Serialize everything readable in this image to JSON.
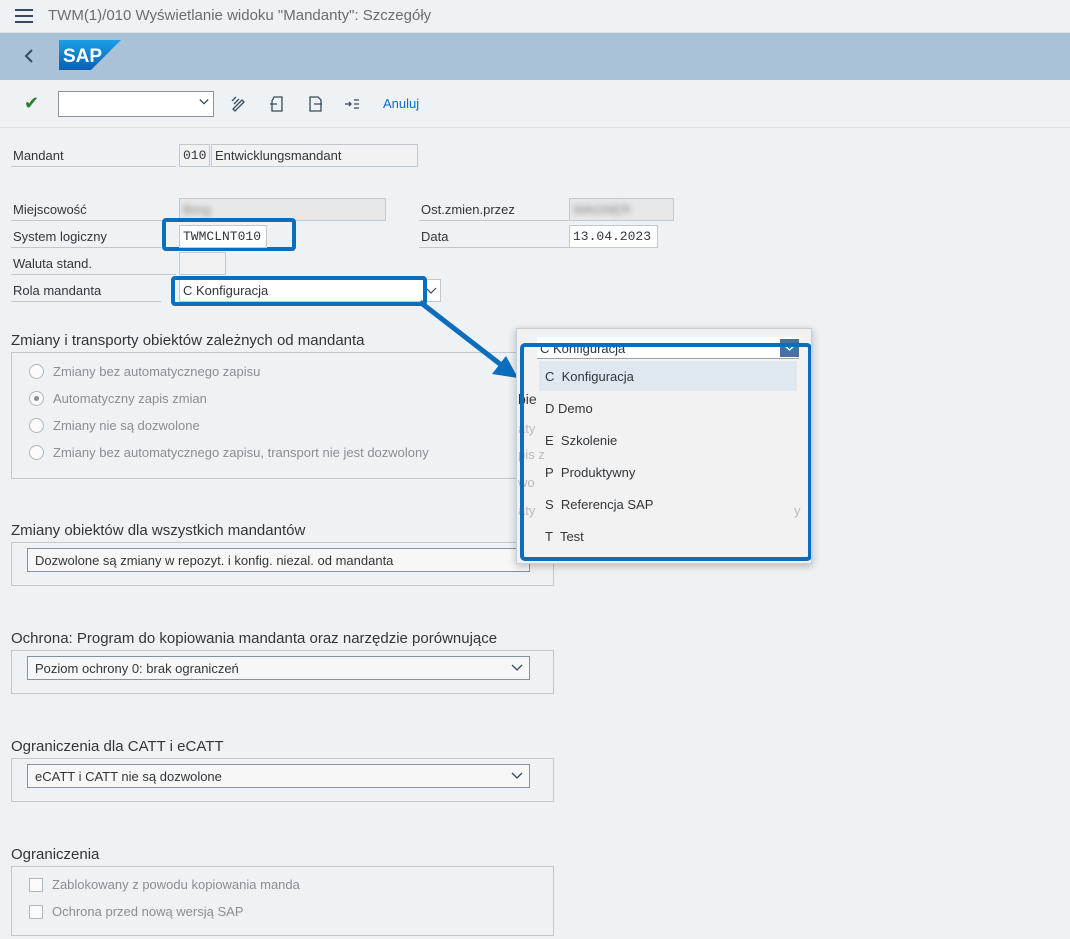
{
  "window": {
    "title": "TWM(1)/010 Wyświetlanie widoku \"Mandanty\": Szczegóły"
  },
  "toolbar": {
    "cancel_label": "Anuluj",
    "command_value": ""
  },
  "form": {
    "mandant_label": "Mandant",
    "mandant_value": "010",
    "mandant_name": "Entwicklungsmandant",
    "city_label": "Miejscowość",
    "city_value": "Berg",
    "changed_by_label": "Ost.zmien.przez",
    "changed_by_value": "WAGNER",
    "logical_system_label": "System logiczny",
    "logical_system_value": "TWMCLNT010",
    "date_label": "Data",
    "date_value": "13.04.2023",
    "currency_label": "Waluta stand.",
    "currency_value": "",
    "role_label": "Rola mandanta",
    "role_value": "C Konfiguracja"
  },
  "client_changes": {
    "title": "Zmiany i transporty obiektów zależnych od mandanta",
    "options": [
      "Zmiany bez automatycznego zapisu",
      "Automatyczny zapis zmian",
      "Zmiany nie są dozwolone",
      "Zmiany bez automatycznego zapisu, transport nie jest dozwolony"
    ],
    "selected_index": 1
  },
  "cross_client": {
    "title": "Zmiany obiektów dla wszystkich mandantów",
    "value": "Dozwolone są zmiany w repozyt. i konfig. niezal. od mandanta"
  },
  "protection": {
    "title": "Ochrona: Program do kopiowania mandanta oraz narzędzie porównujące",
    "value": "Poziom ochrony 0: brak ograniczeń"
  },
  "catt": {
    "title": "Ograniczenia dla CATT i eCATT",
    "value": "eCATT i CATT nie są dozwolone"
  },
  "restrictions": {
    "title": "Ograniczenia",
    "items": [
      "Zablokowany z powodu kopiowania manda",
      "Ochrona przed nową wersją SAP"
    ]
  },
  "dropdown": {
    "current": "C Konfiguracja",
    "items": [
      {
        "key": "C",
        "text": "Konfiguracja"
      },
      {
        "key": "D",
        "text": "Demo"
      },
      {
        "key": "E",
        "text": "Szkolenie"
      },
      {
        "key": "P",
        "text": "Produktywny"
      },
      {
        "key": "S",
        "text": "Referencja SAP"
      },
      {
        "key": "T",
        "text": "Test"
      }
    ],
    "background_fragments": [
      "bie",
      "aty",
      "pis z",
      "wo",
      "aty",
      "y"
    ]
  },
  "colors": {
    "highlight": "#0a6ebd",
    "shell": "#a9c2d8",
    "accent": "#0a6ed1"
  }
}
